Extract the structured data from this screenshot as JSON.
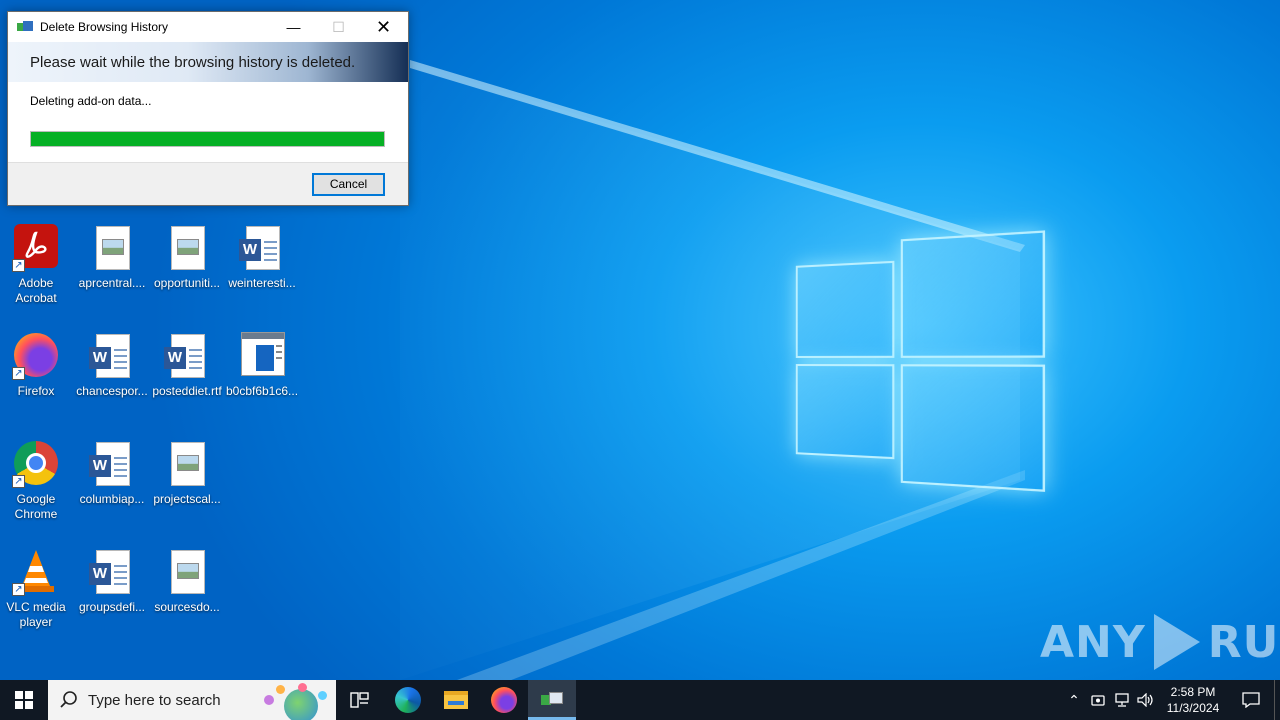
{
  "dialog": {
    "title": "Delete Browsing History",
    "banner_text": "Please wait while the browsing history is deleted.",
    "status_text": "Deleting add-on data...",
    "progress_percent": 100,
    "cancel_label": "Cancel",
    "controls": {
      "minimize": "minimize-icon",
      "maximize": "maximize-icon",
      "close": "close-icon"
    }
  },
  "desktop": {
    "icons": [
      {
        "label": "Adobe\nAcrobat",
        "icon": "adobe-acrobat-icon",
        "shortcut": true
      },
      {
        "label": "aprcentral....",
        "icon": "image-file-icon"
      },
      {
        "label": "opportuniti...",
        "icon": "image-file-icon"
      },
      {
        "label": "weinteresti...",
        "icon": "word-document-icon"
      },
      {
        "label": "Firefox",
        "icon": "firefox-icon",
        "shortcut": true
      },
      {
        "label": "chancespor...",
        "icon": "word-document-icon"
      },
      {
        "label": "posteddiet.rtf",
        "icon": "word-document-icon"
      },
      {
        "label": "b0cbf6b1c6...",
        "icon": "executable-file-icon"
      },
      {
        "label": "Google\nChrome",
        "icon": "chrome-icon",
        "shortcut": true
      },
      {
        "label": "columbiap...",
        "icon": "word-document-icon"
      },
      {
        "label": "projectscal...",
        "icon": "image-file-icon"
      },
      {
        "label": "VLC media\nplayer",
        "icon": "vlc-icon",
        "shortcut": true
      },
      {
        "label": "groupsdefi...",
        "icon": "word-document-icon"
      },
      {
        "label": "sourcesdo...",
        "icon": "image-file-icon"
      }
    ]
  },
  "watermark": {
    "text_left": "ANY",
    "text_right": "RUN"
  },
  "taskbar": {
    "search_placeholder": "Type here to search",
    "pinned": [
      "task-view-icon",
      "edge-icon",
      "file-explorer-icon",
      "firefox-icon",
      "delete-history-app-icon"
    ],
    "clock_time": "2:58 PM",
    "clock_date": "11/3/2024",
    "tray": [
      "chevron-up-icon",
      "meet-now-icon",
      "network-icon",
      "volume-icon"
    ]
  },
  "colors": {
    "progress_fill": "#06b025",
    "taskbar_bg": "#101823",
    "desktop_blue": "#0078d7"
  }
}
